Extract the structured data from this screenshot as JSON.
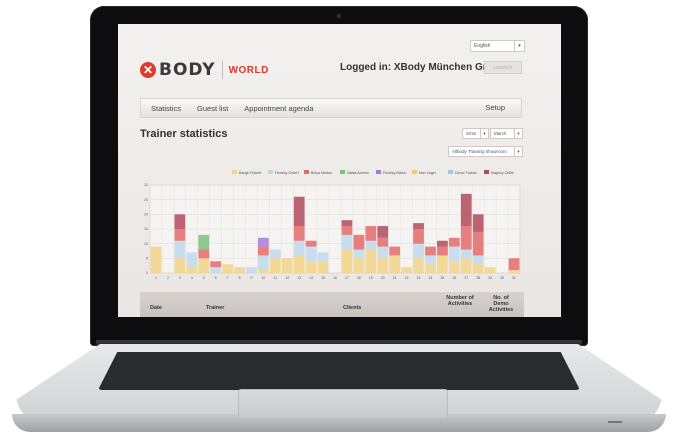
{
  "header": {
    "logo_body": "BODY",
    "logo_world": "WORLD",
    "logged_in": "Logged in: XBody München GmbH",
    "language": "English",
    "logout": "LOGOUT"
  },
  "nav": {
    "items": [
      "Statistics",
      "Guest list",
      "Appointment agenda"
    ],
    "setup": "Setup"
  },
  "page": {
    "title": "Trainer statistics",
    "year": "2016",
    "month": "March",
    "filter": "Allbody Training Showroom"
  },
  "legend": [
    {
      "name": "Baugh Robert",
      "color": "#f2d388"
    },
    {
      "name": "Flemisy GmbH",
      "color": "#bfd8ec"
    },
    {
      "name": "Bölya Merton",
      "color": "#e36a6a"
    },
    {
      "name": "Nabla Adrimo",
      "color": "#7cc07c"
    },
    {
      "name": "Flemisy Bieiou",
      "color": "#a97bd8"
    },
    {
      "name": "Max Vogel",
      "color": "#f5c56f"
    },
    {
      "name": "Demo Trainer",
      "color": "#9ec4e8"
    },
    {
      "name": "Majarcy Zaffre",
      "color": "#b04a5e"
    }
  ],
  "chart_data": {
    "type": "bar",
    "stacked": true,
    "ylim": [
      0,
      30
    ],
    "yticks": [
      0,
      5,
      10,
      15,
      20,
      25,
      30
    ],
    "categories": [
      "1",
      "2",
      "3",
      "4",
      "5",
      "6",
      "7",
      "8",
      "9",
      "10",
      "11",
      "12",
      "13",
      "14",
      "15",
      "16",
      "17",
      "18",
      "19",
      "20",
      "21",
      "22",
      "23",
      "24",
      "25",
      "26",
      "27",
      "28",
      "29",
      "30",
      "31"
    ],
    "series": [
      {
        "name": "Baugh Robert",
        "values": [
          9,
          0,
          5,
          2,
          5,
          0,
          3,
          2,
          0,
          1,
          5,
          5,
          6,
          4,
          4,
          0,
          8,
          5,
          8,
          5,
          6,
          2,
          5,
          3,
          6,
          4,
          5,
          3,
          2,
          0,
          1
        ]
      },
      {
        "name": "Flemisy GmbH",
        "values": [
          0,
          0,
          6,
          5,
          0,
          2,
          0,
          0,
          2,
          5,
          3,
          0,
          5,
          5,
          3,
          0,
          5,
          3,
          3,
          4,
          0,
          0,
          5,
          3,
          0,
          5,
          3,
          3,
          0,
          0,
          0
        ]
      },
      {
        "name": "Bölya Merton",
        "values": [
          0,
          0,
          4,
          0,
          3,
          2,
          0,
          0,
          0,
          3,
          0,
          0,
          5,
          2,
          0,
          0,
          3,
          5,
          5,
          3,
          3,
          0,
          5,
          3,
          3,
          3,
          8,
          8,
          0,
          0,
          4
        ]
      },
      {
        "name": "Nabla Adrimo",
        "values": [
          0,
          0,
          0,
          0,
          5,
          0,
          0,
          0,
          0,
          0,
          0,
          0,
          0,
          0,
          0,
          0,
          0,
          0,
          0,
          0,
          0,
          0,
          0,
          0,
          0,
          0,
          0,
          0,
          0,
          0,
          0
        ]
      },
      {
        "name": "Flemisy Bieiou",
        "values": [
          0,
          0,
          0,
          0,
          0,
          0,
          0,
          0,
          0,
          3,
          0,
          0,
          0,
          0,
          0,
          0,
          0,
          0,
          0,
          0,
          0,
          0,
          0,
          0,
          0,
          0,
          0,
          0,
          0,
          0,
          0
        ]
      },
      {
        "name": "Majarcy Zaffre",
        "values": [
          0,
          0,
          5,
          0,
          0,
          0,
          0,
          0,
          0,
          0,
          0,
          0,
          10,
          0,
          0,
          0,
          2,
          0,
          0,
          4,
          0,
          0,
          2,
          0,
          2,
          0,
          11,
          6,
          0,
          0,
          0
        ]
      }
    ]
  },
  "table": {
    "columns": [
      "Date",
      "Trainer",
      "Clients",
      "Number of Activities",
      "No. of Demo Activities"
    ]
  }
}
